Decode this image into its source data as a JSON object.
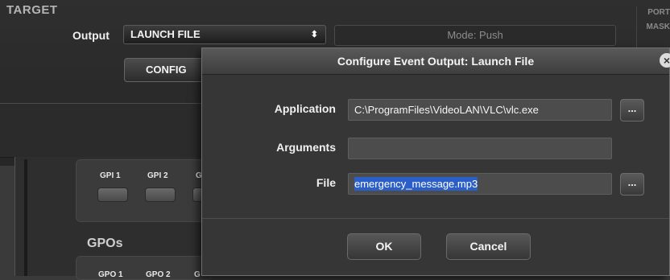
{
  "target": {
    "title": "TARGET",
    "output_label": "Output",
    "output_value": "LAUNCH FILE",
    "select_arrows": "⬍",
    "mode_text": "Mode: Push",
    "config_label": "CONFIG",
    "side_labels": [
      "PORT",
      "MASK"
    ]
  },
  "gpi": {
    "labels": [
      "GPI 1",
      "GPI 2",
      "G"
    ]
  },
  "gpo": {
    "title": "GPOs",
    "labels": [
      "GPO 1",
      "GPO 2",
      "G"
    ]
  },
  "dialog": {
    "title": "Configure Event Output: Launch File",
    "close_glyph": "×",
    "application_label": "Application",
    "application_value": "C:\\ProgramFiles\\VideoLAN\\VLC\\vlc.exe",
    "arguments_label": "Arguments",
    "arguments_value": "",
    "file_label": "File",
    "file_value": "emergency_message.mp3",
    "browse_label": "...",
    "ok_label": "OK",
    "cancel_label": "Cancel"
  },
  "colors": {
    "selection": "#2b5fc7",
    "dialog_bg": "#363636",
    "panel_bg": "#2b2b2b"
  }
}
